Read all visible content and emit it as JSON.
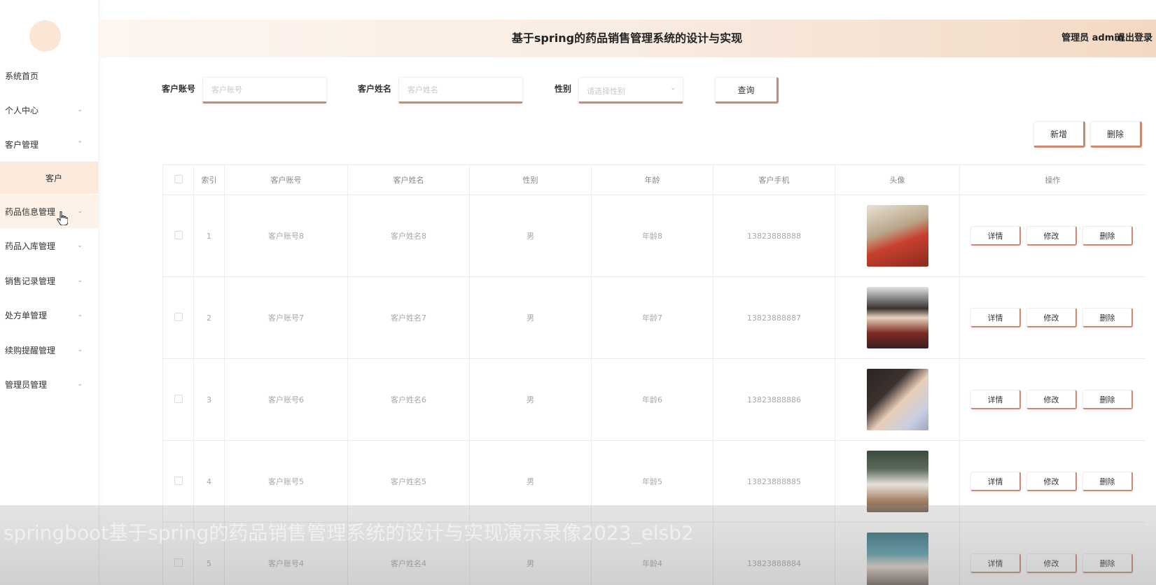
{
  "header": {
    "title": "基于spring的药品销售管理系统的设计与实现",
    "user": "管理员 admin",
    "logout": "退出登录"
  },
  "sidebar": {
    "items": [
      {
        "label": "系统首页"
      },
      {
        "label": "个人中心"
      },
      {
        "label": "客户管理"
      },
      {
        "label": "客户"
      },
      {
        "label": "药品信息管理"
      },
      {
        "label": "药品入库管理"
      },
      {
        "label": "销售记录管理"
      },
      {
        "label": "处方单管理"
      },
      {
        "label": "续购提醒管理"
      },
      {
        "label": "管理员管理"
      }
    ],
    "chevron_down": "⌄",
    "chevron_up": "⌃",
    "cursor_icon": "hand-pointer"
  },
  "search": {
    "account_label": "客户账号",
    "account_placeholder": "客户账号",
    "name_label": "客户姓名",
    "name_placeholder": "客户姓名",
    "gender_label": "性别",
    "gender_placeholder": "请选择性别",
    "query_button": "查询"
  },
  "actions": {
    "add_button": "新增",
    "delete_button": "删除"
  },
  "table": {
    "headers": [
      "索引",
      "客户账号",
      "客户姓名",
      "性别",
      "年龄",
      "客户手机",
      "头像",
      "操作"
    ],
    "rows": [
      {
        "index": "1",
        "account": "客户账号8",
        "name": "客户姓名8",
        "gender": "男",
        "age": "年龄8",
        "phone": "13823888888"
      },
      {
        "index": "2",
        "account": "客户账号7",
        "name": "客户姓名7",
        "gender": "男",
        "age": "年龄7",
        "phone": "13823888887"
      },
      {
        "index": "3",
        "account": "客户账号6",
        "name": "客户姓名6",
        "gender": "男",
        "age": "年龄6",
        "phone": "13823888886"
      },
      {
        "index": "4",
        "account": "客户账号5",
        "name": "客户姓名5",
        "gender": "男",
        "age": "年龄5",
        "phone": "13823888885"
      },
      {
        "index": "5",
        "account": "客户账号4",
        "name": "客户姓名4",
        "gender": "男",
        "age": "年龄4",
        "phone": "13823888884"
      }
    ],
    "row_buttons": {
      "detail": "详情",
      "edit": "修改",
      "delete": "删除"
    }
  },
  "watermark": "springboot基于spring的药品销售管理系统的设计与实现演示录像2023_elsb2",
  "colors": {
    "accent": "#c98a72",
    "header_gradient_end": "#f2d9c4",
    "submenu_bg": "#fbe9dc"
  }
}
